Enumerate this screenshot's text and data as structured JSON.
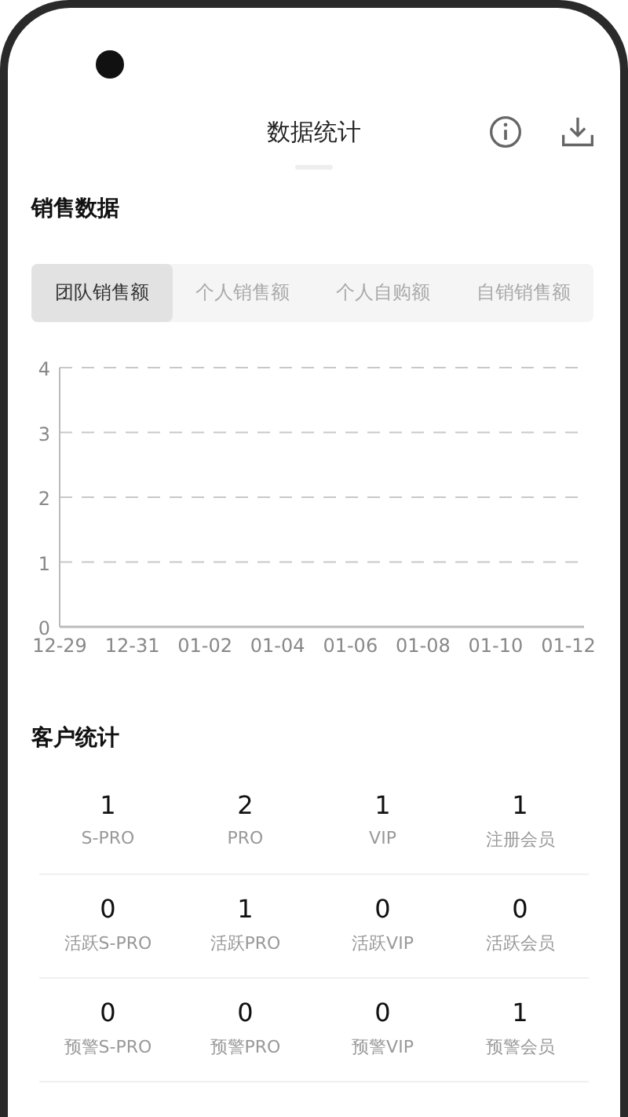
{
  "header": {
    "title": "数据统计"
  },
  "sales": {
    "title": "销售数据",
    "tabs": [
      {
        "label": "团队销售额",
        "selected": true
      },
      {
        "label": "个人销售额",
        "selected": false
      },
      {
        "label": "个人自购额",
        "selected": false
      },
      {
        "label": "自销销售额",
        "selected": false
      }
    ],
    "chart_data": {
      "type": "line",
      "categories": [
        "12-29",
        "12-31",
        "01-02",
        "01-04",
        "01-06",
        "01-08",
        "01-10",
        "01-12"
      ],
      "ylim": [
        0,
        4
      ],
      "grid": true,
      "yticks": [
        0,
        1,
        2,
        3,
        4
      ]
    }
  },
  "customers": {
    "title": "客户统计",
    "rows": [
      [
        {
          "value": "1",
          "label": "S-PRO"
        },
        {
          "value": "2",
          "label": "PRO"
        },
        {
          "value": "1",
          "label": "VIP"
        },
        {
          "value": "1",
          "label": "注册会员"
        }
      ],
      [
        {
          "value": "0",
          "label": "活跃S-PRO"
        },
        {
          "value": "1",
          "label": "活跃PRO"
        },
        {
          "value": "0",
          "label": "活跃VIP"
        },
        {
          "value": "0",
          "label": "活跃会员"
        }
      ],
      [
        {
          "value": "0",
          "label": "预警S-PRO"
        },
        {
          "value": "0",
          "label": "预警PRO"
        },
        {
          "value": "0",
          "label": "预警VIP"
        },
        {
          "value": "1",
          "label": "预警会员"
        }
      ]
    ]
  }
}
